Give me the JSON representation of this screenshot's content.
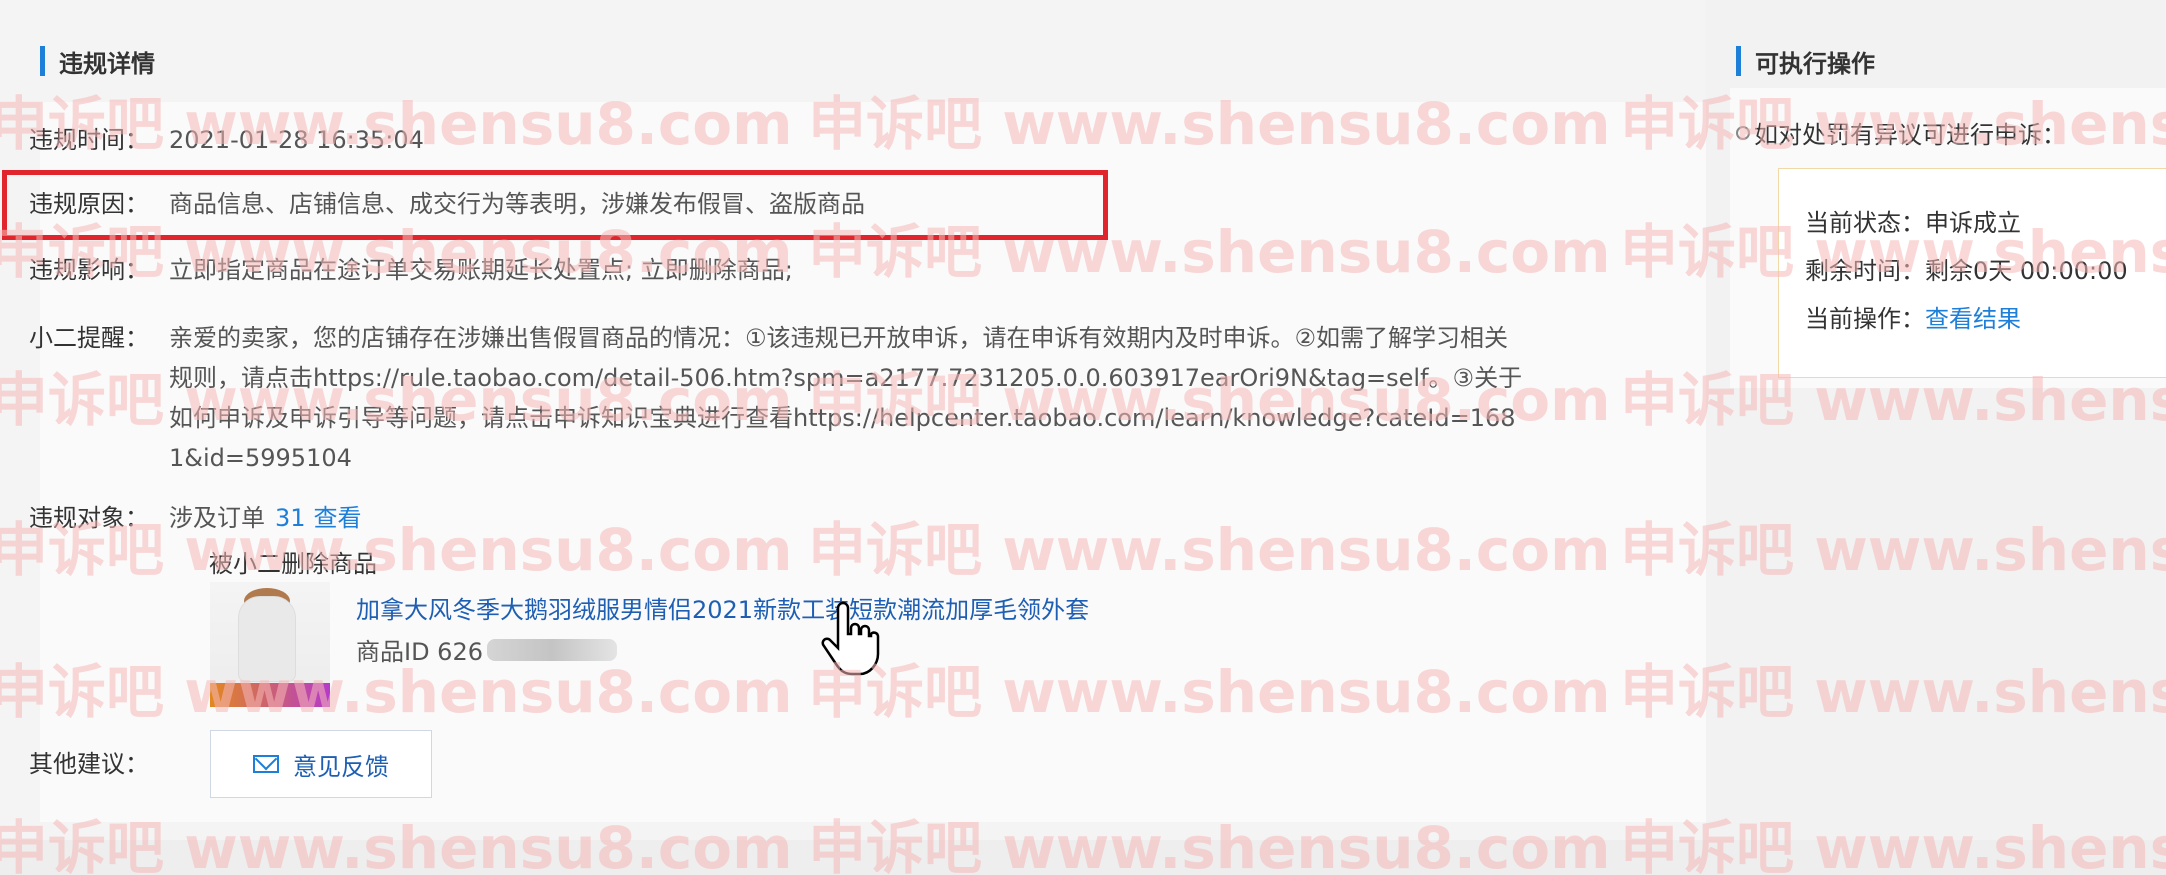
{
  "left": {
    "title": "违规详情",
    "time": {
      "label": "违规时间：",
      "value": "2021-01-28 16:35:04"
    },
    "reason": {
      "label": "违规原因：",
      "value": "商品信息、店铺信息、成交行为等表明，涉嫌发布假冒、盗版商品"
    },
    "impact": {
      "label": "违规影响：",
      "value": "立即指定商品在途订单交易账期延长处置点; 立即删除商品;"
    },
    "reminder": {
      "label": "小二提醒：",
      "value": "亲爱的卖家，您的店铺存在涉嫌出售假冒商品的情况：①该违规已开放申诉，请在申诉有效期内及时申诉。②如需了解学习相关规则，请点击https://rule.taobao.com/detail-506.htm?spm=a2177.7231205.0.0.603917earOri9N&tag=self。③关于如何申诉及申诉引导等问题，请点击申诉知识宝典进行查看https://helpcenter.taobao.com/learn/knowledge?cateId=1681&id=5995104"
    },
    "target": {
      "label": "违规对象：",
      "prefix": "涉及订单",
      "count": "31",
      "view": "查看"
    },
    "deleted_label": "被小二删除商品",
    "product": {
      "title": "加拿大风冬季大鹅羽绒服男情侣2021新款工装短款潮流加厚毛领外套",
      "id_label": "商品ID 626"
    },
    "suggestion": {
      "label": "其他建议：",
      "button": "意见反馈"
    }
  },
  "right": {
    "title": "可执行操作",
    "prompt": "如对处罚有异议可进行申诉：",
    "status": {
      "label": "当前状态：",
      "value": "申诉成立"
    },
    "remaining": {
      "label": "剩余时间：",
      "value": "剩余0天 00:00:00"
    },
    "action": {
      "label": "当前操作：",
      "value": "查看结果"
    }
  },
  "watermark": "申诉吧 www.shensu8.com",
  "colors": {
    "accent": "#1e7fd9",
    "highlight": "#e0262c",
    "watermark": "#f7c8c8"
  }
}
